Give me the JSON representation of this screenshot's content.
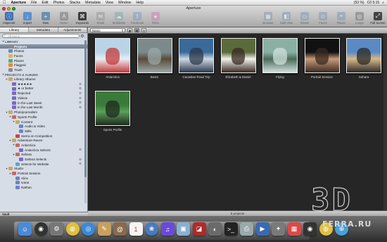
{
  "menubar": {
    "items": [
      "Aperture",
      "File",
      "Edit",
      "Photos",
      "Stacks",
      "Metadata",
      "View",
      "Window",
      "Help"
    ],
    "right": {
      "battery": "(53 %)",
      "clock": "Сб 5:15"
    }
  },
  "window": {
    "title": "Aperture"
  },
  "toolbar": {
    "left": [
      {
        "label": "Inspector",
        "icon": "inspector-icon"
      },
      {
        "label": "Import",
        "icon": "import-icon"
      },
      {
        "label": "New",
        "icon": "new-icon"
      },
      {
        "label": "Name",
        "icon": "name-icon"
      },
      {
        "label": "Keywords",
        "icon": "keywords-icon"
      },
      {
        "label": "Email",
        "icon": "email-icon"
      },
      {
        "label": "MobileMe",
        "icon": "mobileme-icon"
      },
      {
        "label": "Facebook",
        "icon": "facebook-icon"
      },
      {
        "label": "Flickr",
        "icon": "flickr-icon"
      }
    ],
    "right": [
      {
        "label": "Browser",
        "icon": "browser-icon"
      },
      {
        "label": "Split View",
        "icon": "split-view-icon"
      },
      {
        "label": "Viewer",
        "icon": "viewer-icon"
      },
      {
        "label": "Faces",
        "icon": "faces-icon"
      },
      {
        "label": "Places",
        "icon": "places-icon"
      },
      {
        "label": "Loupe",
        "icon": "loupe-icon"
      },
      {
        "label": "Full Screen",
        "icon": "full-screen-icon"
      }
    ]
  },
  "sidebar": {
    "tabs": [
      "Library",
      "Metadata",
      "Adjustments"
    ],
    "active_tab": "Library",
    "search_placeholder": "All Items",
    "rows": [
      {
        "text": "LIBRARY",
        "kind": "header",
        "depth": 0
      },
      {
        "text": "Projects",
        "kind": "item",
        "depth": 1,
        "icon": "gray",
        "selected": true
      },
      {
        "text": "Photos",
        "kind": "item",
        "depth": 1,
        "icon": "blue"
      },
      {
        "text": "Faces",
        "kind": "item",
        "depth": 1,
        "icon": "yellow"
      },
      {
        "text": "Places",
        "kind": "item",
        "depth": 1,
        "icon": "green"
      },
      {
        "text": "Flagged",
        "kind": "item",
        "depth": 1,
        "icon": "orange"
      },
      {
        "text": "Trash",
        "kind": "item",
        "depth": 1,
        "icon": "gray"
      },
      {
        "text": "PROJECTS & ALBUMS",
        "kind": "header",
        "depth": 0
      },
      {
        "text": "Library Albums",
        "kind": "item",
        "depth": 1,
        "icon": "folder",
        "open": true
      },
      {
        "text": "★★★★★",
        "kind": "item",
        "depth": 2,
        "icon": "purple",
        "cog": true
      },
      {
        "text": "★ or better",
        "kind": "item",
        "depth": 2,
        "icon": "purple",
        "cog": true
      },
      {
        "text": "Rejected",
        "kind": "item",
        "depth": 2,
        "icon": "purple",
        "cog": true
      },
      {
        "text": "Videos",
        "kind": "item",
        "depth": 2,
        "icon": "purple",
        "cog": true
      },
      {
        "text": "In the Last Week",
        "kind": "item",
        "depth": 2,
        "icon": "purple",
        "cog": true
      },
      {
        "text": "In the Last Month",
        "kind": "item",
        "depth": 2,
        "icon": "purple",
        "cog": true
      },
      {
        "text": "Photojournalism",
        "kind": "item",
        "depth": 1,
        "icon": "folder",
        "open": true
      },
      {
        "text": "Sports Profile",
        "kind": "item",
        "depth": 2,
        "icon": "book",
        "open": true
      },
      {
        "text": "Content",
        "kind": "item",
        "depth": 3,
        "icon": "folder",
        "open": true
      },
      {
        "text": "Audio & Video",
        "kind": "item",
        "depth": 4,
        "icon": "blue"
      },
      {
        "text": "Stills",
        "kind": "item",
        "depth": 4,
        "icon": "blue"
      },
      {
        "text": "Sierra on Competition",
        "kind": "item",
        "depth": 3,
        "icon": "red"
      },
      {
        "text": "Adventure Races",
        "kind": "item",
        "depth": 2,
        "icon": "folder",
        "open": true
      },
      {
        "text": "Antarctica",
        "kind": "item",
        "depth": 3,
        "icon": "book",
        "open": true
      },
      {
        "text": "Antarctica Selects",
        "kind": "item",
        "depth": 4,
        "icon": "purple",
        "cog": true
      },
      {
        "text": "Sahara",
        "kind": "item",
        "depth": 3,
        "icon": "book",
        "open": true
      },
      {
        "text": "Sahara Selects",
        "kind": "item",
        "depth": 4,
        "icon": "purple",
        "cog": true
      },
      {
        "text": "Selects for Website",
        "kind": "item",
        "depth": 3,
        "icon": "cyan",
        "cog": true
      },
      {
        "text": "Studio",
        "kind": "item",
        "depth": 1,
        "icon": "folder",
        "open": true
      },
      {
        "text": "Portrait Session",
        "kind": "item",
        "depth": 2,
        "icon": "book",
        "open": true
      },
      {
        "text": "Alice",
        "kind": "item",
        "depth": 3,
        "icon": "blue"
      },
      {
        "text": "Ivana",
        "kind": "item",
        "depth": 3,
        "icon": "blue"
      },
      {
        "text": "Nathan",
        "kind": "item",
        "depth": 3,
        "icon": "blue"
      }
    ],
    "vault_label": "Vault"
  },
  "browser": {
    "sort_label": "Name",
    "projects": [
      {
        "name": "Antarctica",
        "colors": [
          "#b9d4e6",
          "#e8eef4",
          "#c43a3a"
        ]
      },
      {
        "name": "Bears",
        "colors": [
          "#7c8a8c",
          "#5a4a3a",
          "#9aa8a8"
        ]
      },
      {
        "name": "Canadian Road Trip",
        "colors": [
          "#3a6a9a",
          "#cfd8e4",
          "#2c3a4a"
        ]
      },
      {
        "name": "Elizabeth & Daniel",
        "colors": [
          "#5a6a3a",
          "#f2f2ee",
          "#3a2a22"
        ]
      },
      {
        "name": "Flying",
        "colors": [
          "#8ab0a4",
          "#4a6a5a",
          "#d0e0dc"
        ]
      },
      {
        "name": "Portrait Session",
        "colors": [
          "#111111",
          "#c89a78",
          "#3a2a22"
        ]
      },
      {
        "name": "Sahara",
        "colors": [
          "#5a8ac4",
          "#d8b888",
          "#2a2a2a"
        ]
      },
      {
        "name": "Sports Profile",
        "colors": [
          "#3a7a3a",
          "#5aa05a",
          "#1e2a1e"
        ]
      }
    ],
    "status": "8 projects"
  },
  "dock": {
    "icons": [
      "finder-icon",
      "dashboard-icon",
      "system-preferences-icon",
      "chrome-icon",
      "safari-icon",
      "notes-icon",
      "address-book-icon",
      "calendar-icon",
      "iphoto-icon",
      "itunes-icon",
      "preview-icon",
      "photo-booth-icon",
      "aperture-icon",
      "terminal-icon",
      "screenshot-icon",
      "keynote-icon",
      "pixelmator-icon",
      "ical-icon",
      "camera-icon",
      "chrome-2-icon",
      "world-icon"
    ]
  },
  "watermark": {
    "big": "3D",
    "small": "FERRA.RU"
  }
}
